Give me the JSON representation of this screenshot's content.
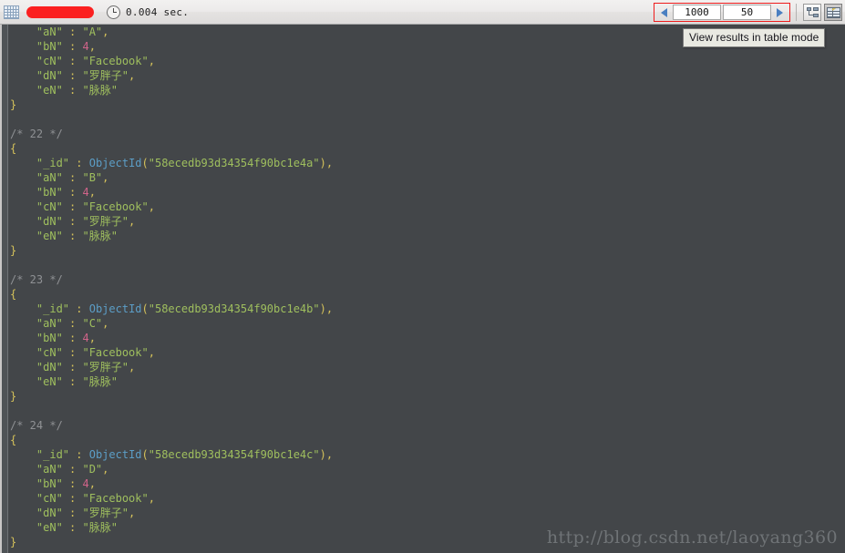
{
  "toolbar": {
    "grid_icon": "table-grid-icon",
    "redacted_label": "",
    "clock_icon": "clock-icon",
    "execution_time": "0.004 sec.",
    "prev_arrow": "◀",
    "next_arrow": "▶",
    "skip_value": "1000",
    "limit_value": "50",
    "skip_placeholder": "0",
    "limit_placeholder": "50",
    "tree_mode_icon": "tree-view-icon",
    "table_mode_icon": "table-view-icon",
    "accent_red": "#ee1c1c",
    "accent_blue": "#4a7fc1"
  },
  "tooltip": {
    "text": "View results in table mode"
  },
  "watermark": {
    "text": "http://blog.csdn.net/laoyang360"
  },
  "colors": {
    "background": "#434649",
    "key": "#9fbf5e",
    "string": "#9fbf5e",
    "number": "#d0648a",
    "punctuation": "#d4c15a",
    "function": "#5c9ec7",
    "comment": "#8f9194",
    "brace": "#d4c15a"
  },
  "results": {
    "partial_first_document": {
      "fields": [
        {
          "key": "\"aN\"",
          "value": "\"A\"",
          "type": "string",
          "comma": true
        },
        {
          "key": "\"bN\"",
          "value": "4",
          "type": "number",
          "comma": true
        },
        {
          "key": "\"cN\"",
          "value": "\"Facebook\"",
          "type": "string",
          "comma": true
        },
        {
          "key": "\"dN\"",
          "value": "\"罗胖子\"",
          "type": "string",
          "comma": true
        },
        {
          "key": "\"eN\"",
          "value": "\"脉脉\"",
          "type": "string",
          "comma": false
        }
      ]
    },
    "documents": [
      {
        "comment": "/* 22 */",
        "fields": [
          {
            "key": "\"_id\"",
            "value": "58ecedb93d34354f90bc1e4a",
            "type": "objectid",
            "comma": true
          },
          {
            "key": "\"aN\"",
            "value": "\"B\"",
            "type": "string",
            "comma": true
          },
          {
            "key": "\"bN\"",
            "value": "4",
            "type": "number",
            "comma": true
          },
          {
            "key": "\"cN\"",
            "value": "\"Facebook\"",
            "type": "string",
            "comma": true
          },
          {
            "key": "\"dN\"",
            "value": "\"罗胖子\"",
            "type": "string",
            "comma": true
          },
          {
            "key": "\"eN\"",
            "value": "\"脉脉\"",
            "type": "string",
            "comma": false
          }
        ]
      },
      {
        "comment": "/* 23 */",
        "fields": [
          {
            "key": "\"_id\"",
            "value": "58ecedb93d34354f90bc1e4b",
            "type": "objectid",
            "comma": true
          },
          {
            "key": "\"aN\"",
            "value": "\"C\"",
            "type": "string",
            "comma": true
          },
          {
            "key": "\"bN\"",
            "value": "4",
            "type": "number",
            "comma": true
          },
          {
            "key": "\"cN\"",
            "value": "\"Facebook\"",
            "type": "string",
            "comma": true
          },
          {
            "key": "\"dN\"",
            "value": "\"罗胖子\"",
            "type": "string",
            "comma": true
          },
          {
            "key": "\"eN\"",
            "value": "\"脉脉\"",
            "type": "string",
            "comma": false
          }
        ]
      },
      {
        "comment": "/* 24 */",
        "fields": [
          {
            "key": "\"_id\"",
            "value": "58ecedb93d34354f90bc1e4c",
            "type": "objectid",
            "comma": true
          },
          {
            "key": "\"aN\"",
            "value": "\"D\"",
            "type": "string",
            "comma": true
          },
          {
            "key": "\"bN\"",
            "value": "4",
            "type": "number",
            "comma": true
          },
          {
            "key": "\"cN\"",
            "value": "\"Facebook\"",
            "type": "string",
            "comma": true
          },
          {
            "key": "\"dN\"",
            "value": "\"罗胖子\"",
            "type": "string",
            "comma": true
          },
          {
            "key": "\"eN\"",
            "value": "\"脉脉\"",
            "type": "string",
            "comma": false
          }
        ]
      }
    ],
    "objectid_fn": "ObjectId",
    "open_brace": "{",
    "close_brace": "}"
  }
}
